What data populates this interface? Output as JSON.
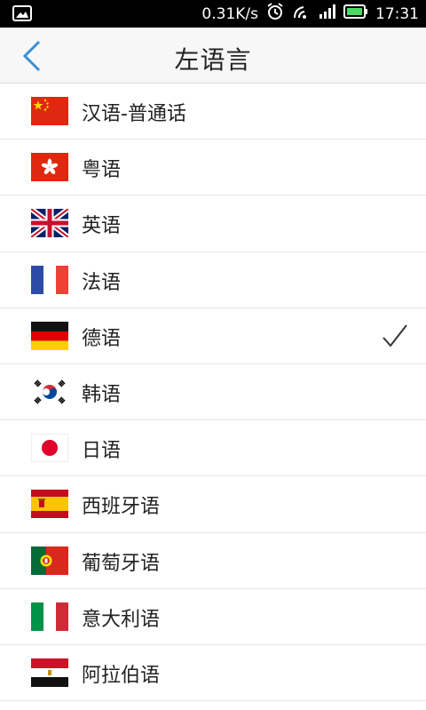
{
  "status": {
    "net_speed": "0.31K/s",
    "time": "17:31"
  },
  "header": {
    "title": "左语言"
  },
  "languages": [
    {
      "label": "汉语-普通话",
      "flag": "china-flag-icon"
    },
    {
      "label": "粤语",
      "flag": "hong-kong-flag-icon"
    },
    {
      "label": "英语",
      "flag": "uk-flag-icon"
    },
    {
      "label": "法语",
      "flag": "france-flag-icon"
    },
    {
      "label": "德语",
      "flag": "germany-flag-icon",
      "selected": true
    },
    {
      "label": "韩语",
      "flag": "korea-flag-icon"
    },
    {
      "label": "日语",
      "flag": "japan-flag-icon"
    },
    {
      "label": "西班牙语",
      "flag": "spain-flag-icon"
    },
    {
      "label": "葡萄牙语",
      "flag": "portugal-flag-icon"
    },
    {
      "label": "意大利语",
      "flag": "italy-flag-icon"
    },
    {
      "label": "阿拉伯语",
      "flag": "egypt-flag-icon"
    }
  ],
  "colors": {
    "accent": "#3a8fd6",
    "status_bar": "#000000",
    "header_bg": "#f7f7f7"
  }
}
